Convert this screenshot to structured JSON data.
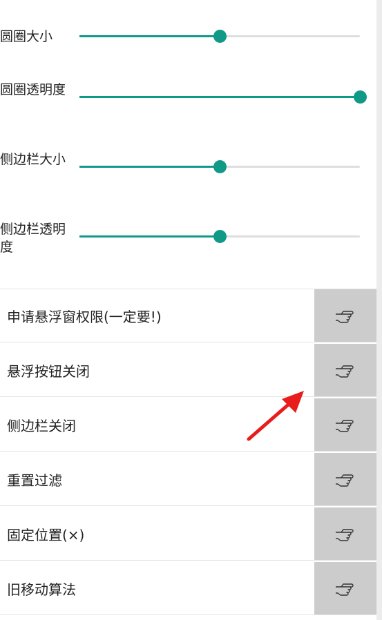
{
  "sliders": [
    {
      "label": "圆圈大小",
      "value": 0.5
    },
    {
      "label": "圆圈透明度",
      "value": 1.0
    },
    {
      "label": "侧边栏大小",
      "value": 0.5
    },
    {
      "label": "侧边栏透明度",
      "value": 0.5
    }
  ],
  "buttons": [
    {
      "label": "申请悬浮窗权限(一定要!)",
      "icon": "pointing-hand-icon"
    },
    {
      "label": "悬浮按钮关闭",
      "icon": "pointing-hand-icon"
    },
    {
      "label": "侧边栏关闭",
      "icon": "pointing-hand-icon"
    },
    {
      "label": "重置过滤",
      "icon": "pointing-hand-icon"
    },
    {
      "label": "固定位置(×)",
      "icon": "pointing-hand-icon"
    },
    {
      "label": "旧移动算法",
      "icon": "pointing-hand-icon"
    }
  ],
  "colors": {
    "accent": "#119988",
    "track": "#dedede",
    "action_bg": "#cccccc",
    "annotation": "#e81c1c"
  }
}
